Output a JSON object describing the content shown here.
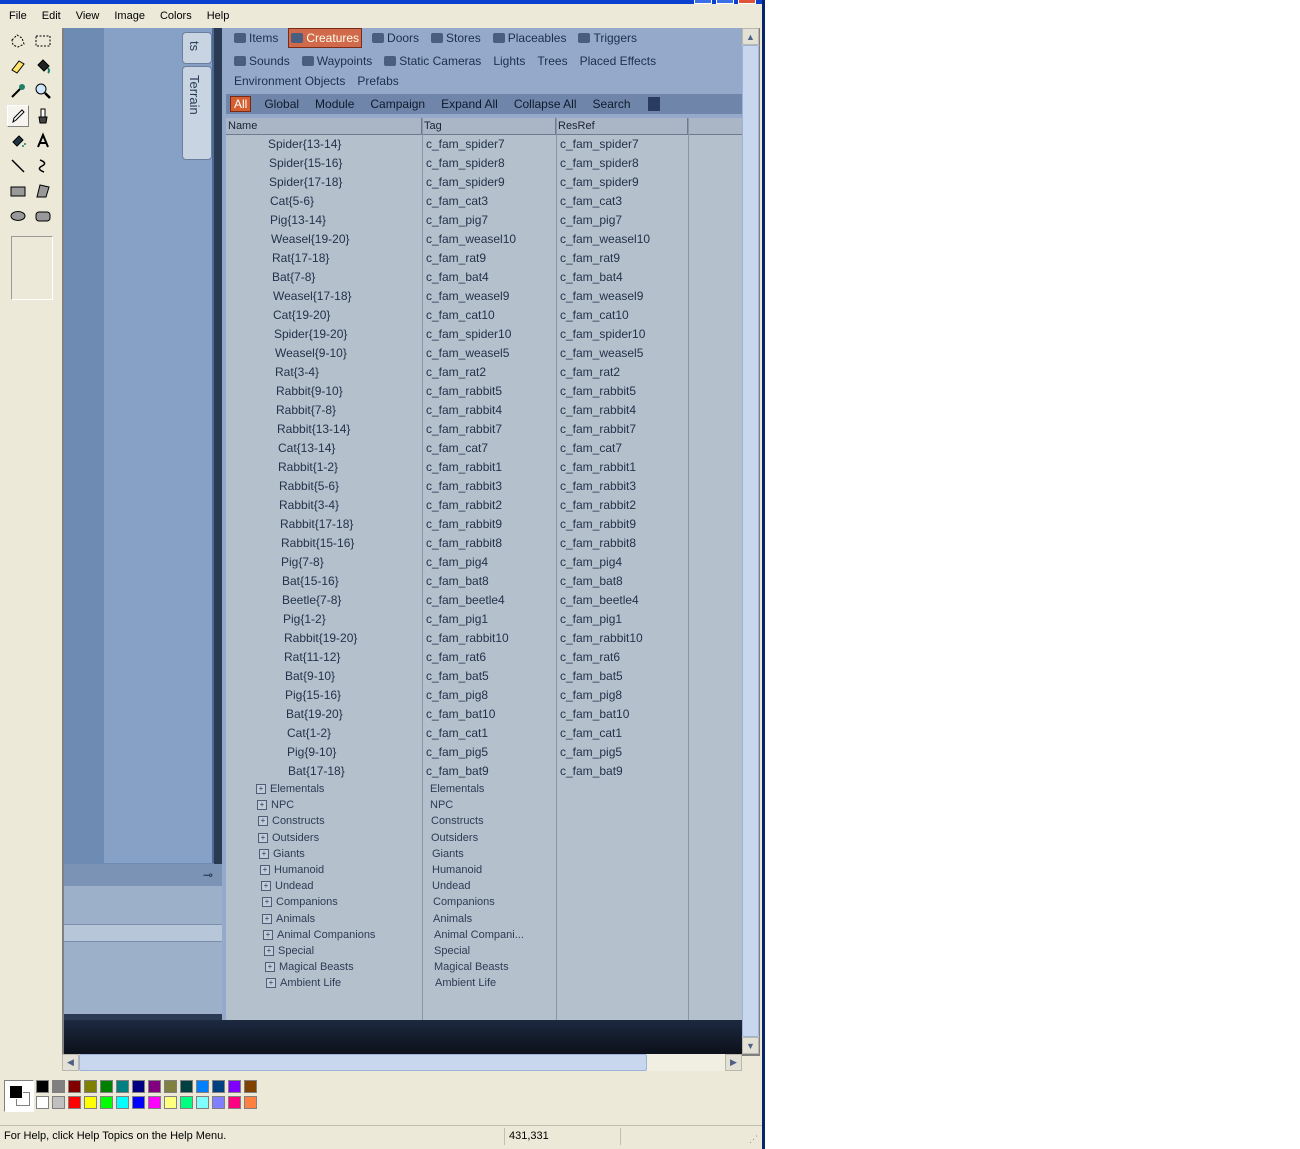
{
  "menu": [
    "File",
    "Edit",
    "View",
    "Image",
    "Colors",
    "Help"
  ],
  "tools": [
    {
      "name": "free-form-select-icon"
    },
    {
      "name": "rectangle-select-icon"
    },
    {
      "name": "eraser-icon"
    },
    {
      "name": "fill-bucket-icon"
    },
    {
      "name": "color-picker-icon"
    },
    {
      "name": "magnifier-icon"
    },
    {
      "name": "pencil-icon",
      "active": true
    },
    {
      "name": "brush-icon"
    },
    {
      "name": "airbrush-icon"
    },
    {
      "name": "text-icon"
    },
    {
      "name": "line-icon"
    },
    {
      "name": "curve-icon"
    },
    {
      "name": "rectangle-icon"
    },
    {
      "name": "polygon-icon"
    },
    {
      "name": "ellipse-icon"
    },
    {
      "name": "rounded-rectangle-icon"
    }
  ],
  "photo": {
    "side_tabs": [
      "Terrain"
    ],
    "side_tab_top": "ts",
    "category_tabs_row1": [
      "Items",
      "Creatures",
      "Doors",
      "Stores",
      "Placeables",
      "Triggers"
    ],
    "category_tabs_row2": [
      "Sounds",
      "Waypoints",
      "Static Cameras",
      "Lights",
      "Trees",
      "Placed Effects"
    ],
    "category_tabs_row3": [
      "Environment Objects",
      "Prefabs"
    ],
    "selected_category": "Creatures",
    "filters": [
      "All",
      "Global",
      "Module",
      "Campaign",
      "Expand All",
      "Collapse All",
      "Search"
    ],
    "selected_filter": "All",
    "columns": {
      "name": "Name",
      "tag": "Tag",
      "resref": "ResRef"
    },
    "rows": [
      {
        "name": "Spider{13-14}",
        "tag": "c_fam_spider7",
        "resref": "c_fam_spider7"
      },
      {
        "name": "Spider{15-16}",
        "tag": "c_fam_spider8",
        "resref": "c_fam_spider8"
      },
      {
        "name": "Spider{17-18}",
        "tag": "c_fam_spider9",
        "resref": "c_fam_spider9"
      },
      {
        "name": "Cat{5-6}",
        "tag": "c_fam_cat3",
        "resref": "c_fam_cat3"
      },
      {
        "name": "Pig{13-14}",
        "tag": "c_fam_pig7",
        "resref": "c_fam_pig7"
      },
      {
        "name": "Weasel{19-20}",
        "tag": "c_fam_weasel10",
        "resref": "c_fam_weasel10"
      },
      {
        "name": "Rat{17-18}",
        "tag": "c_fam_rat9",
        "resref": "c_fam_rat9"
      },
      {
        "name": "Bat{7-8}",
        "tag": "c_fam_bat4",
        "resref": "c_fam_bat4"
      },
      {
        "name": "Weasel{17-18}",
        "tag": "c_fam_weasel9",
        "resref": "c_fam_weasel9"
      },
      {
        "name": "Cat{19-20}",
        "tag": "c_fam_cat10",
        "resref": "c_fam_cat10"
      },
      {
        "name": "Spider{19-20}",
        "tag": "c_fam_spider10",
        "resref": "c_fam_spider10"
      },
      {
        "name": "Weasel{9-10}",
        "tag": "c_fam_weasel5",
        "resref": "c_fam_weasel5"
      },
      {
        "name": "Rat{3-4}",
        "tag": "c_fam_rat2",
        "resref": "c_fam_rat2"
      },
      {
        "name": "Rabbit{9-10}",
        "tag": "c_fam_rabbit5",
        "resref": "c_fam_rabbit5"
      },
      {
        "name": "Rabbit{7-8}",
        "tag": "c_fam_rabbit4",
        "resref": "c_fam_rabbit4"
      },
      {
        "name": "Rabbit{13-14}",
        "tag": "c_fam_rabbit7",
        "resref": "c_fam_rabbit7"
      },
      {
        "name": "Cat{13-14}",
        "tag": "c_fam_cat7",
        "resref": "c_fam_cat7"
      },
      {
        "name": "Rabbit{1-2}",
        "tag": "c_fam_rabbit1",
        "resref": "c_fam_rabbit1"
      },
      {
        "name": "Rabbit{5-6}",
        "tag": "c_fam_rabbit3",
        "resref": "c_fam_rabbit3"
      },
      {
        "name": "Rabbit{3-4}",
        "tag": "c_fam_rabbit2",
        "resref": "c_fam_rabbit2"
      },
      {
        "name": "Rabbit{17-18}",
        "tag": "c_fam_rabbit9",
        "resref": "c_fam_rabbit9"
      },
      {
        "name": "Rabbit{15-16}",
        "tag": "c_fam_rabbit8",
        "resref": "c_fam_rabbit8"
      },
      {
        "name": "Pig{7-8}",
        "tag": "c_fam_pig4",
        "resref": "c_fam_pig4"
      },
      {
        "name": "Bat{15-16}",
        "tag": "c_fam_bat8",
        "resref": "c_fam_bat8"
      },
      {
        "name": "Beetle{7-8}",
        "tag": "c_fam_beetle4",
        "resref": "c_fam_beetle4"
      },
      {
        "name": "Pig{1-2}",
        "tag": "c_fam_pig1",
        "resref": "c_fam_pig1"
      },
      {
        "name": "Rabbit{19-20}",
        "tag": "c_fam_rabbit10",
        "resref": "c_fam_rabbit10"
      },
      {
        "name": "Rat{11-12}",
        "tag": "c_fam_rat6",
        "resref": "c_fam_rat6"
      },
      {
        "name": "Bat{9-10}",
        "tag": "c_fam_bat5",
        "resref": "c_fam_bat5"
      },
      {
        "name": "Pig{15-16}",
        "tag": "c_fam_pig8",
        "resref": "c_fam_pig8"
      },
      {
        "name": "Bat{19-20}",
        "tag": "c_fam_bat10",
        "resref": "c_fam_bat10"
      },
      {
        "name": "Cat{1-2}",
        "tag": "c_fam_cat1",
        "resref": "c_fam_cat1"
      },
      {
        "name": "Pig{9-10}",
        "tag": "c_fam_pig5",
        "resref": "c_fam_pig5"
      },
      {
        "name": "Bat{17-18}",
        "tag": "c_fam_bat9",
        "resref": "c_fam_bat9"
      }
    ],
    "groups": [
      {
        "name": "Elementals",
        "tag": "Elementals"
      },
      {
        "name": "NPC",
        "tag": "NPC"
      },
      {
        "name": "Constructs",
        "tag": "Constructs"
      },
      {
        "name": "Outsiders",
        "tag": "Outsiders"
      },
      {
        "name": "Giants",
        "tag": "Giants"
      },
      {
        "name": "Humanoid",
        "tag": "Humanoid"
      },
      {
        "name": "Undead",
        "tag": "Undead"
      },
      {
        "name": "Companions",
        "tag": "Companions"
      },
      {
        "name": "Animals",
        "tag": "Animals"
      },
      {
        "name": "Animal Companions",
        "tag": "Animal Compani..."
      },
      {
        "name": "Special",
        "tag": "Special"
      },
      {
        "name": "Magical Beasts",
        "tag": "Magical Beasts"
      },
      {
        "name": "Ambient Life",
        "tag": "Ambient Life"
      }
    ]
  },
  "palette": {
    "foreground": "#000000",
    "background": "#ffffff",
    "top_row": [
      "#000000",
      "#808080",
      "#800000",
      "#808000",
      "#008000",
      "#008080",
      "#000080",
      "#800080",
      "#808040",
      "#004040",
      "#0080ff",
      "#004080",
      "#8000ff",
      "#804000"
    ],
    "bottom_row": [
      "#ffffff",
      "#c0c0c0",
      "#ff0000",
      "#ffff00",
      "#00ff00",
      "#00ffff",
      "#0000ff",
      "#ff00ff",
      "#ffff80",
      "#00ff80",
      "#80ffff",
      "#8080ff",
      "#ff0080",
      "#ff8040"
    ]
  },
  "status": {
    "help_text": "For Help, click Help Topics on the Help Menu.",
    "coordinates": "431,331"
  }
}
